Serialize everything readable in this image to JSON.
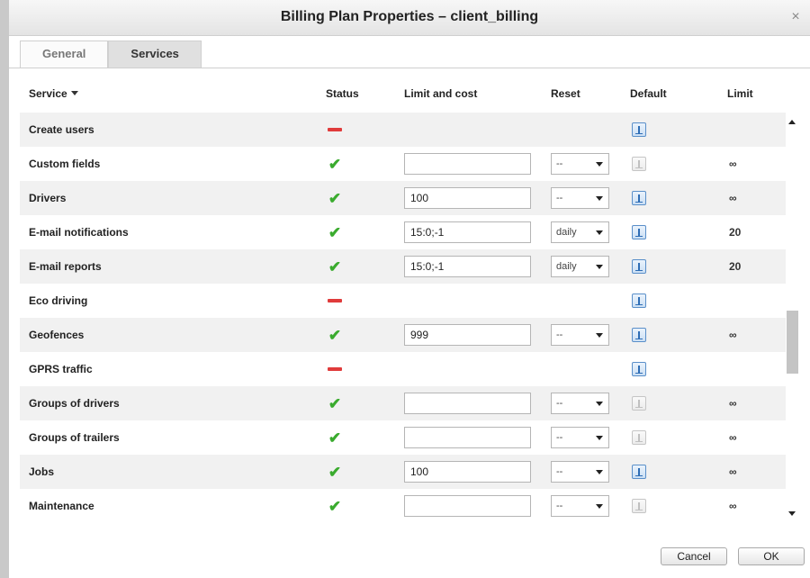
{
  "window": {
    "title": "Billing Plan Properties – client_billing",
    "close_glyph": "×"
  },
  "tabs": [
    {
      "label": "General",
      "active": false
    },
    {
      "label": "Services",
      "active": true
    }
  ],
  "table": {
    "columns": {
      "service": "Service",
      "status": "Status",
      "limit_cost": "Limit and cost",
      "reset": "Reset",
      "default": "Default",
      "limit": "Limit"
    },
    "sort_indicator": "chevron-down-icon",
    "rows": [
      {
        "service": "Create users",
        "status": "off",
        "limit_cost": null,
        "reset": null,
        "default_active": true,
        "limit": ""
      },
      {
        "service": "Custom fields",
        "status": "on",
        "limit_cost": "",
        "reset": "--",
        "default_active": false,
        "limit": "∞"
      },
      {
        "service": "Drivers",
        "status": "on",
        "limit_cost": "100",
        "reset": "--",
        "default_active": true,
        "limit": "∞"
      },
      {
        "service": "E-mail notifications",
        "status": "on",
        "limit_cost": "15:0;-1",
        "reset": "daily",
        "default_active": true,
        "limit": "20"
      },
      {
        "service": "E-mail reports",
        "status": "on",
        "limit_cost": "15:0;-1",
        "reset": "daily",
        "default_active": true,
        "limit": "20"
      },
      {
        "service": "Eco driving",
        "status": "off",
        "limit_cost": null,
        "reset": null,
        "default_active": true,
        "limit": ""
      },
      {
        "service": "Geofences",
        "status": "on",
        "limit_cost": "999",
        "reset": "--",
        "default_active": true,
        "limit": "∞"
      },
      {
        "service": "GPRS traffic",
        "status": "off",
        "limit_cost": null,
        "reset": null,
        "default_active": true,
        "limit": ""
      },
      {
        "service": "Groups of drivers",
        "status": "on",
        "limit_cost": "",
        "reset": "--",
        "default_active": false,
        "limit": "∞"
      },
      {
        "service": "Groups of trailers",
        "status": "on",
        "limit_cost": "",
        "reset": "--",
        "default_active": false,
        "limit": "∞"
      },
      {
        "service": "Jobs",
        "status": "on",
        "limit_cost": "100",
        "reset": "--",
        "default_active": true,
        "limit": "∞"
      },
      {
        "service": "Maintenance",
        "status": "on",
        "limit_cost": "",
        "reset": "--",
        "default_active": false,
        "limit": "∞"
      }
    ]
  },
  "footer": {
    "cancel_label": "Cancel",
    "ok_label": "OK"
  },
  "colors": {
    "check": "#3aab2e",
    "dash": "#e03b3b",
    "info_icon": "#5a8fc9"
  }
}
